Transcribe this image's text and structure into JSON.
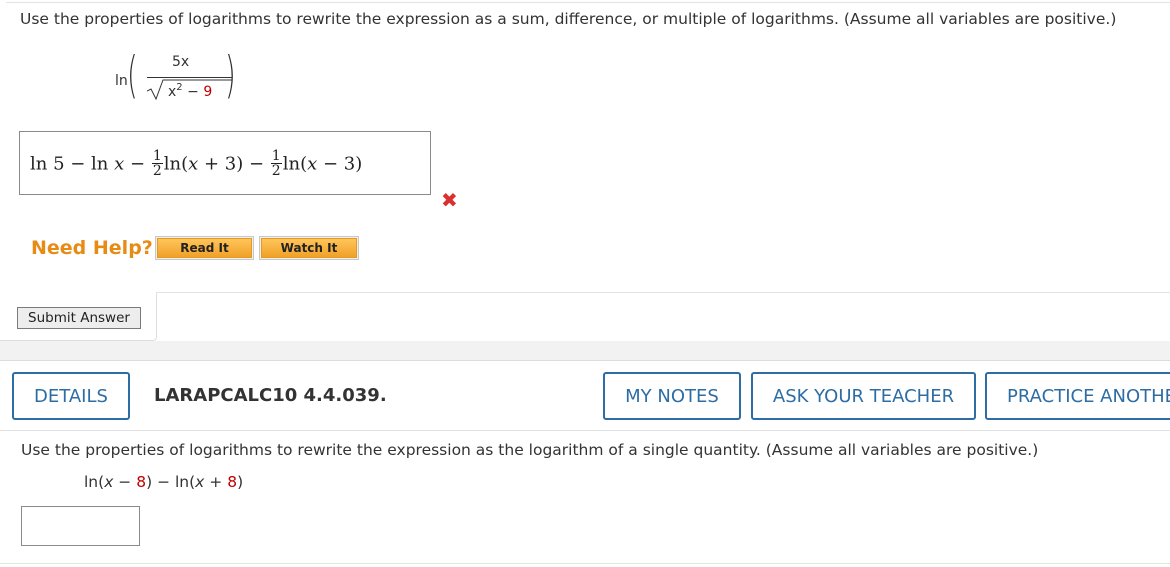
{
  "question1": {
    "instruction": "Use the properties of logarithms to rewrite the expression as a sum, difference, or multiple of logarithms. (Assume all variables are positive.)",
    "expression": {
      "fn": "ln",
      "numerator": "5x",
      "denominator_base": "x",
      "denominator_exp": "2",
      "denominator_op": " − ",
      "denominator_const": "9"
    },
    "answer": {
      "t1": "ln 5 − ln ",
      "v1": "x",
      "t2": " − ",
      "f1_num": "1",
      "f1_den": "2",
      "t3": "ln(",
      "v2": "x",
      "t4": " + 3) − ",
      "f2_num": "1",
      "f2_den": "2",
      "t5": "ln(",
      "v3": "x",
      "t6": " − 3)"
    },
    "result_mark": "✖",
    "need_help_label": "Need Help?",
    "read_it_label": "Read It",
    "watch_it_label": "Watch It",
    "submit_label": "Submit Answer"
  },
  "question2": {
    "details_label": "DETAILS",
    "problem_id": "LARAPCALC10 4.4.039.",
    "my_notes_label": "MY NOTES",
    "ask_teacher_label": "ASK YOUR TEACHER",
    "practice_label": "PRACTICE ANOTHER",
    "instruction": "Use the properties of logarithms to rewrite the expression as the logarithm of a single quantity. (Assume all variables are positive.)",
    "expression": {
      "p1": "ln(",
      "v1": "x",
      "p2": " − ",
      "c1": "8",
      "p3": ") − ln(",
      "v2": "x",
      "p4": " + ",
      "c2": "8",
      "p5": ")"
    },
    "answer_value": ""
  },
  "colors": {
    "accent_blue": "#2d6da3",
    "help_orange": "#e88b15",
    "error_red": "#d93030",
    "highlight_red": "#c00000"
  },
  "icons": {
    "wrong": "x-mark-icon"
  }
}
